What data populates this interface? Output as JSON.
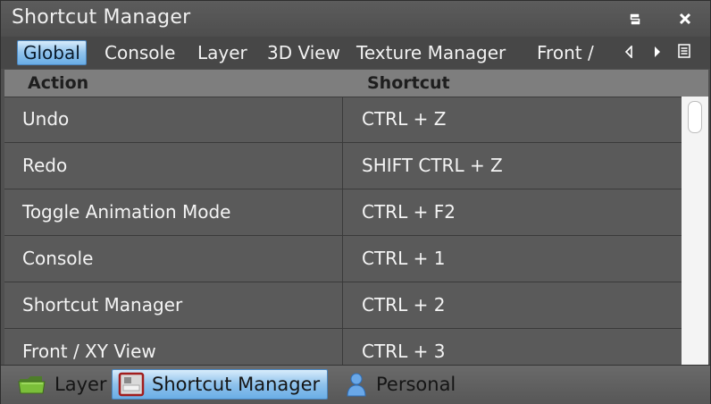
{
  "window": {
    "title": "Shortcut Manager"
  },
  "tabs": [
    {
      "label": "Global",
      "active": true
    },
    {
      "label": "Console",
      "active": false
    },
    {
      "label": "Layer",
      "active": false
    },
    {
      "label": "3D View",
      "active": false
    },
    {
      "label": "Texture Manager",
      "active": false
    },
    {
      "label": "Front /",
      "active": false
    }
  ],
  "table": {
    "columns": [
      "Action",
      "Shortcut"
    ],
    "rows": [
      {
        "action": "Undo",
        "shortcut": "CTRL + Z"
      },
      {
        "action": "Redo",
        "shortcut": "SHIFT CTRL + Z"
      },
      {
        "action": "Toggle Animation Mode",
        "shortcut": "CTRL + F2"
      },
      {
        "action": "Console",
        "shortcut": "CTRL + 1"
      },
      {
        "action": "Shortcut Manager",
        "shortcut": "CTRL + 2"
      },
      {
        "action": "Front / XY View",
        "shortcut": "CTRL + 3"
      }
    ]
  },
  "bottom_tabs": [
    {
      "label": "Layer",
      "icon": "folder-icon",
      "active": false
    },
    {
      "label": "Shortcut Manager",
      "icon": "keyboard-icon",
      "active": true
    },
    {
      "label": "Personal",
      "icon": "person-icon",
      "active": false
    }
  ],
  "colors": {
    "accent": "#8fc2ec",
    "background": "#505050",
    "header": "#7e7e7e"
  }
}
